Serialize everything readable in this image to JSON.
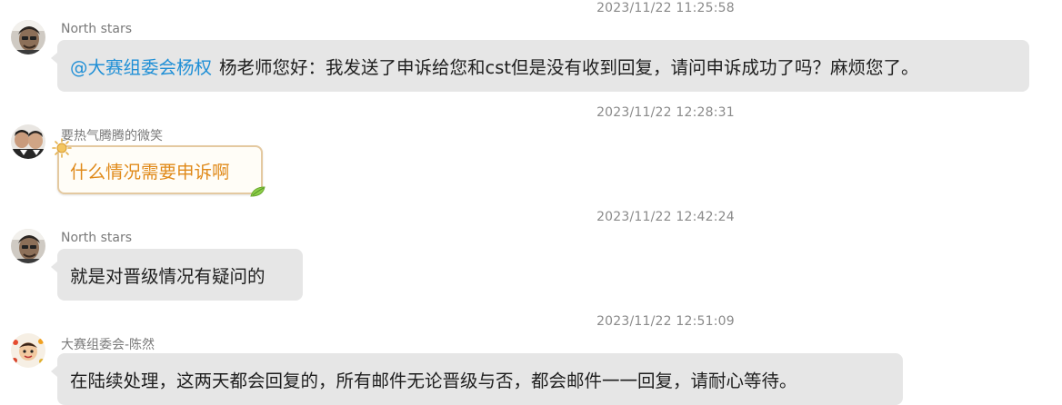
{
  "colors": {
    "mention": "#1f8fd6",
    "bubble_bg": "#e6e6e6",
    "special_text": "#e08a1a",
    "special_border": "#e4c9a0",
    "timestamp": "#8a8a8a",
    "sender": "#7a7a7a"
  },
  "messages": [
    {
      "timestamp": "2023/11/22 11:25:58",
      "sender": "North stars",
      "mention": "@大赛组委会杨权",
      "text": "杨老师您好：我发送了申诉给您和cst但是没有收到回复，请问申诉成功了吗？麻烦您了。"
    },
    {
      "timestamp": "2023/11/22 12:28:31",
      "sender": "要热气腾腾的微笑",
      "text": "什么情况需要申诉啊"
    },
    {
      "timestamp": "2023/11/22 12:42:24",
      "sender": "North stars",
      "text": "就是对晋级情况有疑问的"
    },
    {
      "timestamp": "2023/11/22 12:51:09",
      "sender": "大赛组委会-陈然",
      "text": "在陆续处理，这两天都会回复的，所有邮件无论晋级与否，都会邮件一一回复，请耐心等待。"
    }
  ]
}
